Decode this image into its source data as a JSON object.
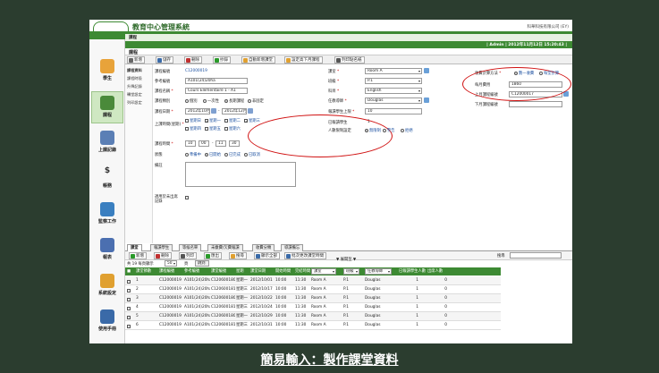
{
  "app": {
    "title": "教育中心管理系統",
    "company": "科華科技有限公司 (EY)",
    "breadcrumb": "課程",
    "user_bar": "| Admin | 2012年11月12日 15:20:43 |",
    "page_title": "課程"
  },
  "sidebar": {
    "items": [
      {
        "label": "學生",
        "icon": "student-icon",
        "color": "#e8a33a"
      },
      {
        "label": "課程",
        "icon": "course-icon",
        "color": "#4a8a3a"
      },
      {
        "label": "上課記錄",
        "icon": "attendance-icon",
        "color": "#5b7fb5"
      },
      {
        "label": "$\n帳務",
        "icon": "billing-icon",
        "color": "#f2f2f2"
      },
      {
        "label": "監察工作",
        "icon": "monitor-icon",
        "color": "#3a7fc0"
      },
      {
        "label": "報表",
        "icon": "report-icon",
        "color": "#4b6fb0"
      },
      {
        "label": "系統設定",
        "icon": "settings-icon",
        "color": "#e0a030"
      },
      {
        "label": "使用手冊",
        "icon": "manual-icon",
        "color": "#3a6aa8"
      }
    ]
  },
  "toolbar": {
    "buttons": [
      "新增",
      "儲存",
      "刪除",
      "抄錄",
      "自動新增課堂",
      "設定高下月課程",
      "列印點名紙"
    ]
  },
  "left_tabs": [
    "課程資料",
    "課程時段",
    "升降記錄",
    "轉堂設定",
    "列印設定"
  ],
  "form": {
    "labels": {
      "course_id": "課程編號",
      "ref_id": "參考編號",
      "course_name": "課程名稱",
      "course_type": "課程類別",
      "course_date": "課程日期",
      "weekdays": "上課時間(星期)",
      "course_time": "課程時間",
      "status": "狀態",
      "remarks": "備註",
      "apply_absent": "適用於未出席記錄",
      "classroom": "課室",
      "level": "班級",
      "subject": "科目",
      "teacher": "任教導師",
      "max_students": "報讀學生上限",
      "enrolled": "已報讀學生",
      "count_setting": "人數限制設定",
      "fee_method": "收費計算方法",
      "monthly_fee": "每月費用",
      "prev_course": "上月課程編號",
      "next_course": "下月課程編號"
    },
    "values": {
      "course_id": "C12000019",
      "ref_id": "A101(24)20ha",
      "course_name": "Cours Elementaire 1 - A1",
      "date_from": "2012年10月1",
      "date_to": "2012年12月31",
      "time_from_h": "10",
      "time_from_m": "00",
      "time_to_h": "11",
      "time_to_m": "30",
      "classroom": "Room A",
      "level": "P.1",
      "subject": "English",
      "teacher": "Douglas",
      "max_students": "10",
      "enrolled": "1",
      "monthly_fee": "1860",
      "prev_course": "C12000017",
      "next_course": ""
    },
    "course_types": [
      "個別",
      "一次性",
      "長期課程",
      "非固定"
    ],
    "weekdays": [
      "星期日",
      "星期一",
      "星期二",
      "星期三",
      "星期四",
      "星期五",
      "星期六"
    ],
    "weekday_checked": [
      false,
      true,
      false,
      true,
      false,
      false,
      false
    ],
    "statuses": [
      "準備中",
      "已開始",
      "已完成",
      "已取消"
    ],
    "count_options": [
      "無限制",
      "警告",
      "拒絕"
    ],
    "fee_options": [
      "劃一收費",
      "每堂計算"
    ]
  },
  "bottom_tabs": [
    "課堂",
    "報讀學生",
    "等候名單",
    "未繳費/欠費報讀",
    "收費分類",
    "導讀備忘"
  ],
  "bottom_toolbar": {
    "buttons": [
      "新增",
      "刪除",
      "列印",
      "匯出",
      "搜尋",
      "顯示全部",
      "批次更改課堂時間"
    ],
    "search_label": "搜尋",
    "filter_label": "▼ 展開至 ▼"
  },
  "paging": {
    "text": "共 19  每頁顯示",
    "size": "50",
    "page_label": "頁",
    "goto": "跳到"
  },
  "grid": {
    "columns": [
      "課堂節數",
      "課程編號",
      "參考編號",
      "課堂編號",
      "星期",
      "課堂日期",
      "開始時間",
      "完結時間",
      "課室",
      "班級",
      "任教導師",
      "已報讀學生人數",
      "出席人數"
    ],
    "filters": [
      "課室",
      "班級",
      "任教導師"
    ],
    "rows": [
      [
        "1",
        "C12000019",
        "A101(24)20ha",
        "C1206001803",
        "星期一",
        "2012/10/01",
        "10:00",
        "11:30",
        "Room A",
        "P.1",
        "Douglas",
        "1",
        "0"
      ],
      [
        "2",
        "C12000019",
        "A101(24)20ha",
        "C1206001812",
        "星期三",
        "2012/10/17",
        "10:00",
        "11:30",
        "Room A",
        "P.1",
        "Douglas",
        "1",
        "0"
      ],
      [
        "3",
        "C12000019",
        "A101(24)20ha",
        "C1206001804",
        "星期一",
        "2012/10/22",
        "10:00",
        "11:30",
        "Room A",
        "P.1",
        "Douglas",
        "1",
        "0"
      ],
      [
        "4",
        "C12000019",
        "A101(24)20ha",
        "C1206001813",
        "星期三",
        "2012/10/24",
        "10:00",
        "11:30",
        "Room A",
        "P.1",
        "Douglas",
        "1",
        "0"
      ],
      [
        "5",
        "C12000019",
        "A101(24)20ha",
        "C1206001805",
        "星期一",
        "2012/10/29",
        "10:00",
        "11:30",
        "Room A",
        "P.1",
        "Douglas",
        "1",
        "0"
      ],
      [
        "6",
        "C12000019",
        "A101(24)20ha",
        "C1206001815",
        "星期三",
        "2012/10/31",
        "10:00",
        "11:30",
        "Room A",
        "P.1",
        "Douglas",
        "1",
        "0"
      ]
    ]
  },
  "caption": "簡易輸入：製作課堂資料"
}
